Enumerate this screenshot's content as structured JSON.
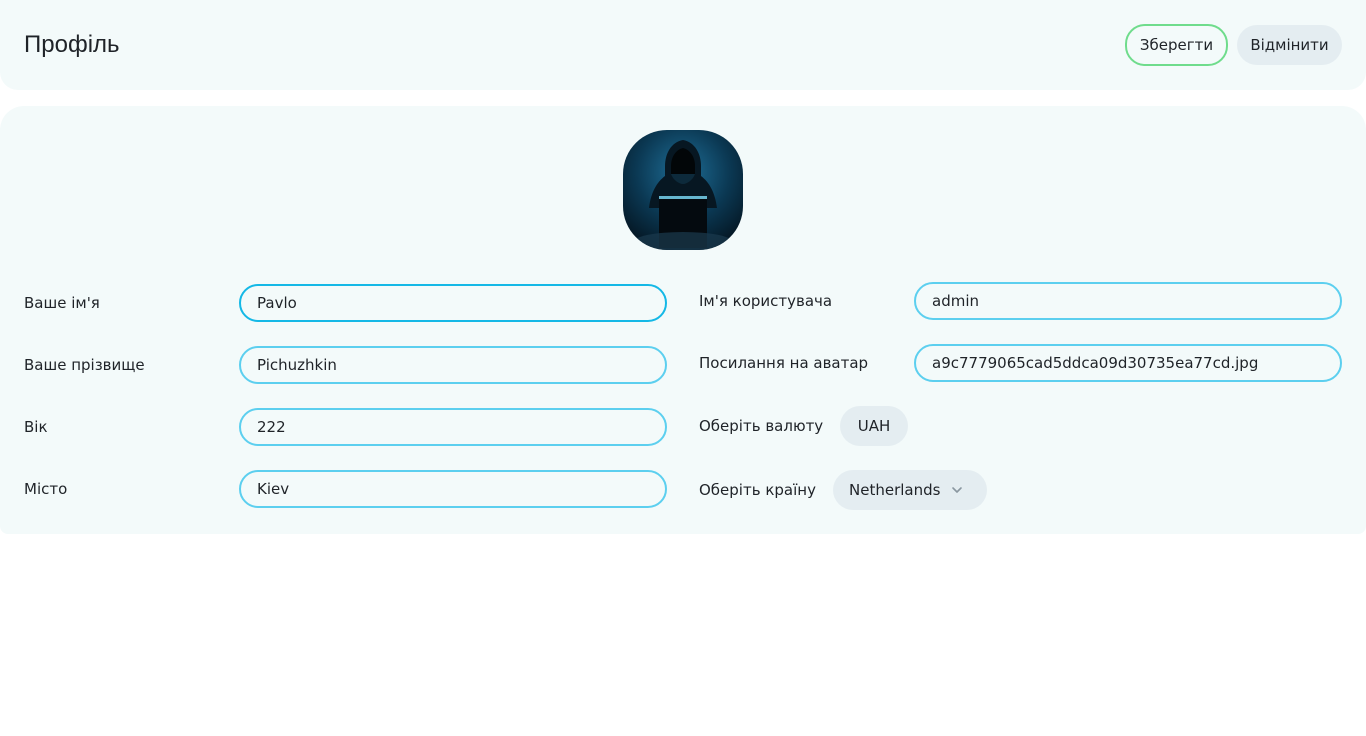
{
  "header": {
    "title": "Профіль",
    "save_label": "Зберегти",
    "cancel_label": "Відмінити"
  },
  "form": {
    "first_name": {
      "label": "Ваше ім'я",
      "value": "Pavlo"
    },
    "last_name": {
      "label": "Ваше прізвище",
      "value": "Pichuzhkin"
    },
    "age": {
      "label": "Вік",
      "value": "222"
    },
    "city": {
      "label": "Місто",
      "value": "Kiev"
    },
    "username": {
      "label": "Ім'я користувача",
      "value": "admin"
    },
    "avatar_link": {
      "label": "Посилання на аватар",
      "value": "a9c7779065cad5ddca09d30735ea77cd.jpg"
    },
    "currency": {
      "label": "Оберіть валюту",
      "value": "UAH"
    },
    "country": {
      "label": "Оберіть країну",
      "value": "Netherlands"
    }
  },
  "icons": {
    "avatar": "hooded-hacker-avatar",
    "country_dropdown": "chevron-down-icon"
  },
  "colors": {
    "background": "#ffffff",
    "panel": "#f3fafa",
    "input_border": "#5ccfef",
    "input_border_focused": "#14b8e6",
    "save_border": "#6fdc8c",
    "chip_bg": "#e4edf1"
  }
}
